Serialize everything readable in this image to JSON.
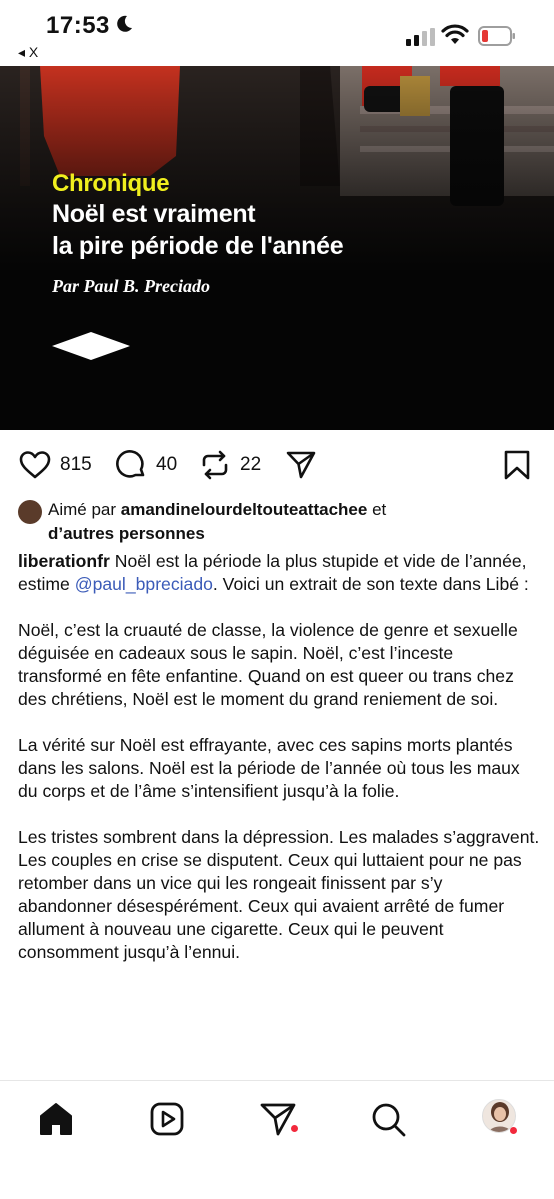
{
  "status": {
    "time": "17:53",
    "back_app": "◂ X"
  },
  "post": {
    "image": {
      "kicker": "Chronique",
      "headline_line1": "Noël est vraiment",
      "headline_line2": "la pire période de l'année",
      "byline": "Par Paul B. Preciado"
    },
    "actions": {
      "likes": "815",
      "comments": "40",
      "reposts": "22"
    },
    "liked_by": {
      "prefix": "Aimé par",
      "user": "amandinelourdeltouteattachee",
      "connector": "et",
      "others": "d’autres personnes"
    },
    "caption": {
      "username": "liberationfr",
      "intro": "Noël est la période la plus stupide et vide de l’année, estime",
      "mention": "@paul_bpreciado",
      "intro_end": ". Voici un extrait de son texte dans Libé :",
      "paragraph2": "Noël, c’est la cruauté de classe, la violence de genre et sexuelle déguisée en cadeaux sous le sapin. Noël, c’est l’inceste transformé en fête enfantine. Quand on est queer ou trans chez des chrétiens, Noël est le moment du grand reniement de soi.",
      "paragraph3": "La vérité sur Noël est effrayante, avec ces sapins morts plantés dans les salons. Noël est la période de l’année où tous les maux du corps et de l’âme s’intensifient jusqu’à la folie.",
      "paragraph4": "Les tristes sombrent dans la dépression. Les malades s’aggravent. Les couples en crise se disputent. Ceux qui luttaient pour ne pas retomber dans un vice qui les rongeait finissent par s’y abandonner désespérément. Ceux qui avaient arrêté de fumer allument à nouveau une cigarette. Ceux qui le peuvent consomment jusqu’à l’ennui."
    }
  },
  "colors": {
    "kicker": "#f0ef1e",
    "mention": "#3b5bb8",
    "notification_dot": "#f2293c",
    "battery_low": "#e53935"
  },
  "icons": {
    "like": "heart-icon",
    "comment": "comment-icon",
    "repost": "repost-icon",
    "share": "send-icon",
    "save": "bookmark-icon",
    "nav": [
      "home-icon",
      "reels-icon",
      "send-icon",
      "search-icon",
      "profile-avatar"
    ]
  }
}
